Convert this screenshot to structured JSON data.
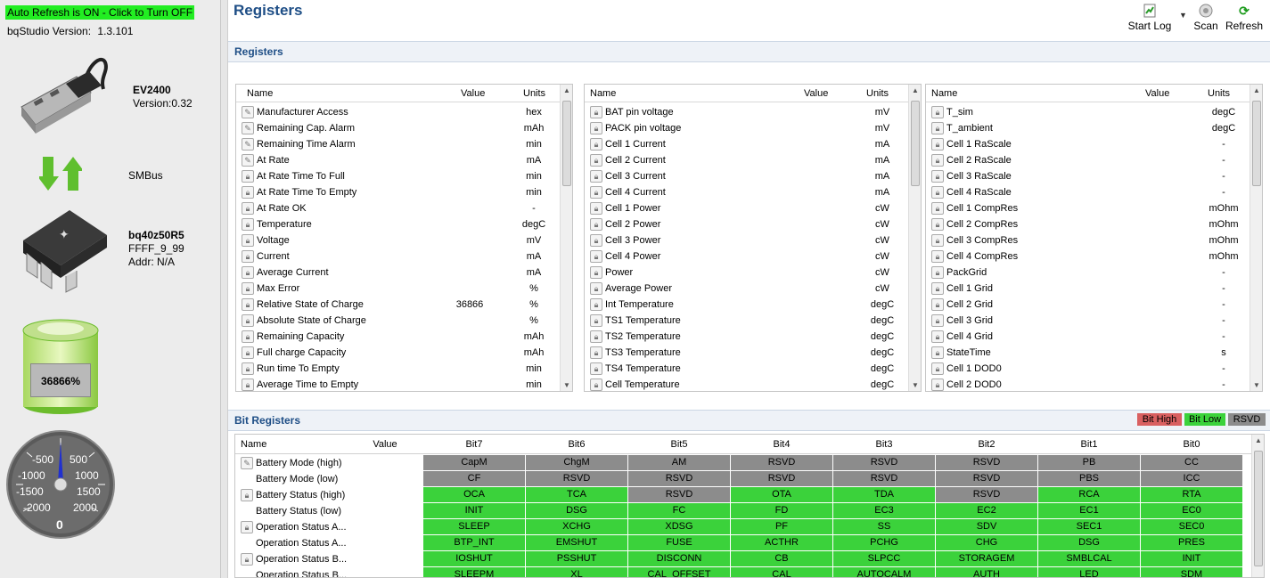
{
  "left": {
    "auto_refresh": "Auto Refresh is ON - Click to Turn OFF",
    "version_label": "bqStudio Version:",
    "version_value": "1.3.101",
    "adapter": {
      "name": "EV2400",
      "version": "Version:0.32"
    },
    "bus": "SMBus",
    "device": {
      "name": "bq40z50R5",
      "fw": "FFFF_9_99",
      "addr": "Addr: N/A"
    },
    "battery_pct": "36866%",
    "gauge": {
      "labels": [
        "-500",
        "-1000",
        "-1500",
        "-2000",
        "500",
        "1000",
        "1500",
        "2000"
      ],
      "value": "0"
    }
  },
  "page": {
    "title": "Registers"
  },
  "toolbar": {
    "start_log": "Start Log",
    "scan": "Scan",
    "refresh": "Refresh"
  },
  "registers": {
    "section_title": "Registers",
    "headers": {
      "name": "Name",
      "value": "Value",
      "units": "Units"
    },
    "col1": [
      {
        "name": "Manufacturer Access",
        "value": "",
        "units": "hex",
        "lock": false
      },
      {
        "name": "Remaining Cap. Alarm",
        "value": "",
        "units": "mAh",
        "lock": false
      },
      {
        "name": "Remaining Time Alarm",
        "value": "",
        "units": "min",
        "lock": false
      },
      {
        "name": "At Rate",
        "value": "",
        "units": "mA",
        "lock": false
      },
      {
        "name": "At Rate Time To Full",
        "value": "",
        "units": "min",
        "lock": true
      },
      {
        "name": "At Rate Time To Empty",
        "value": "",
        "units": "min",
        "lock": true
      },
      {
        "name": "At Rate OK",
        "value": "",
        "units": "-",
        "lock": true
      },
      {
        "name": "Temperature",
        "value": "",
        "units": "degC",
        "lock": true
      },
      {
        "name": "Voltage",
        "value": "",
        "units": "mV",
        "lock": true
      },
      {
        "name": "Current",
        "value": "",
        "units": "mA",
        "lock": true
      },
      {
        "name": "Average Current",
        "value": "",
        "units": "mA",
        "lock": true
      },
      {
        "name": "Max Error",
        "value": "",
        "units": "%",
        "lock": true
      },
      {
        "name": "Relative State of Charge",
        "value": "36866",
        "units": "%",
        "lock": true
      },
      {
        "name": "Absolute State of Charge",
        "value": "",
        "units": "%",
        "lock": true
      },
      {
        "name": "Remaining Capacity",
        "value": "",
        "units": "mAh",
        "lock": true
      },
      {
        "name": "Full charge Capacity",
        "value": "",
        "units": "mAh",
        "lock": true
      },
      {
        "name": "Run time To Empty",
        "value": "",
        "units": "min",
        "lock": true
      },
      {
        "name": "Average Time to Empty",
        "value": "",
        "units": "min",
        "lock": true
      }
    ],
    "col2": [
      {
        "name": "BAT pin voltage",
        "value": "",
        "units": "mV",
        "lock": true
      },
      {
        "name": "PACK pin voltage",
        "value": "",
        "units": "mV",
        "lock": true
      },
      {
        "name": "Cell 1 Current",
        "value": "",
        "units": "mA",
        "lock": true
      },
      {
        "name": "Cell 2 Current",
        "value": "",
        "units": "mA",
        "lock": true
      },
      {
        "name": "Cell 3 Current",
        "value": "",
        "units": "mA",
        "lock": true
      },
      {
        "name": "Cell 4 Current",
        "value": "",
        "units": "mA",
        "lock": true
      },
      {
        "name": "Cell 1 Power",
        "value": "",
        "units": "cW",
        "lock": true
      },
      {
        "name": "Cell 2 Power",
        "value": "",
        "units": "cW",
        "lock": true
      },
      {
        "name": "Cell 3 Power",
        "value": "",
        "units": "cW",
        "lock": true
      },
      {
        "name": "Cell 4 Power",
        "value": "",
        "units": "cW",
        "lock": true
      },
      {
        "name": "Power",
        "value": "",
        "units": "cW",
        "lock": true
      },
      {
        "name": "Average Power",
        "value": "",
        "units": "cW",
        "lock": true
      },
      {
        "name": "Int Temperature",
        "value": "",
        "units": "degC",
        "lock": true
      },
      {
        "name": "TS1 Temperature",
        "value": "",
        "units": "degC",
        "lock": true
      },
      {
        "name": "TS2 Temperature",
        "value": "",
        "units": "degC",
        "lock": true
      },
      {
        "name": "TS3 Temperature",
        "value": "",
        "units": "degC",
        "lock": true
      },
      {
        "name": "TS4 Temperature",
        "value": "",
        "units": "degC",
        "lock": true
      },
      {
        "name": "Cell Temperature",
        "value": "",
        "units": "degC",
        "lock": true
      }
    ],
    "col3": [
      {
        "name": "T_sim",
        "value": "",
        "units": "degC",
        "lock": true
      },
      {
        "name": "T_ambient",
        "value": "",
        "units": "degC",
        "lock": true
      },
      {
        "name": "Cell 1 RaScale",
        "value": "",
        "units": "-",
        "lock": true
      },
      {
        "name": "Cell 2 RaScale",
        "value": "",
        "units": "-",
        "lock": true
      },
      {
        "name": "Cell 3 RaScale",
        "value": "",
        "units": "-",
        "lock": true
      },
      {
        "name": "Cell 4 RaScale",
        "value": "",
        "units": "-",
        "lock": true
      },
      {
        "name": "Cell 1 CompRes",
        "value": "",
        "units": "mOhm",
        "lock": true
      },
      {
        "name": "Cell 2 CompRes",
        "value": "",
        "units": "mOhm",
        "lock": true
      },
      {
        "name": "Cell 3 CompRes",
        "value": "",
        "units": "mOhm",
        "lock": true
      },
      {
        "name": "Cell 4 CompRes",
        "value": "",
        "units": "mOhm",
        "lock": true
      },
      {
        "name": "PackGrid",
        "value": "",
        "units": "-",
        "lock": true
      },
      {
        "name": "Cell 1 Grid",
        "value": "",
        "units": "-",
        "lock": true
      },
      {
        "name": "Cell 2 Grid",
        "value": "",
        "units": "-",
        "lock": true
      },
      {
        "name": "Cell 3 Grid",
        "value": "",
        "units": "-",
        "lock": true
      },
      {
        "name": "Cell 4 Grid",
        "value": "",
        "units": "-",
        "lock": true
      },
      {
        "name": "StateTime",
        "value": "",
        "units": "s",
        "lock": true
      },
      {
        "name": "Cell 1 DOD0",
        "value": "",
        "units": "-",
        "lock": true
      },
      {
        "name": "Cell 2 DOD0",
        "value": "",
        "units": "-",
        "lock": true
      }
    ]
  },
  "bit_registers": {
    "section_title": "Bit Registers",
    "legend": {
      "high": "Bit High",
      "low": "Bit Low",
      "rsvd": "RSVD"
    },
    "headers": [
      "Name",
      "Value",
      "Bit7",
      "Bit6",
      "Bit5",
      "Bit4",
      "Bit3",
      "Bit2",
      "Bit1",
      "Bit0"
    ],
    "rows": [
      {
        "name": "Battery Mode (high)",
        "icon": "edit",
        "bits": [
          "CapM",
          "ChgM",
          "AM",
          "RSVD",
          "RSVD",
          "RSVD",
          "PB",
          "CC"
        ],
        "states": [
          "y",
          "y",
          "y",
          "y",
          "y",
          "y",
          "y",
          "y"
        ]
      },
      {
        "name": "Battery Mode (low)",
        "icon": "none",
        "bits": [
          "CF",
          "RSVD",
          "RSVD",
          "RSVD",
          "RSVD",
          "RSVD",
          "PBS",
          "ICC"
        ],
        "states": [
          "y",
          "y",
          "y",
          "y",
          "y",
          "y",
          "y",
          "y"
        ]
      },
      {
        "name": "Battery Status (high)",
        "icon": "lock",
        "bits": [
          "OCA",
          "TCA",
          "RSVD",
          "OTA",
          "TDA",
          "RSVD",
          "RCA",
          "RTA"
        ],
        "states": [
          "g",
          "g",
          "y",
          "g",
          "g",
          "y",
          "g",
          "g"
        ]
      },
      {
        "name": "Battery Status (low)",
        "icon": "none",
        "bits": [
          "INIT",
          "DSG",
          "FC",
          "FD",
          "EC3",
          "EC2",
          "EC1",
          "EC0"
        ],
        "states": [
          "g",
          "g",
          "g",
          "g",
          "g",
          "g",
          "g",
          "g"
        ]
      },
      {
        "name": "Operation Status A...",
        "icon": "lock",
        "bits": [
          "SLEEP",
          "XCHG",
          "XDSG",
          "PF",
          "SS",
          "SDV",
          "SEC1",
          "SEC0"
        ],
        "states": [
          "g",
          "g",
          "g",
          "g",
          "g",
          "g",
          "g",
          "g"
        ]
      },
      {
        "name": "Operation Status A...",
        "icon": "none",
        "bits": [
          "BTP_INT",
          "EMSHUT",
          "FUSE",
          "ACTHR",
          "PCHG",
          "CHG",
          "DSG",
          "PRES"
        ],
        "states": [
          "g",
          "g",
          "g",
          "g",
          "g",
          "g",
          "g",
          "g"
        ]
      },
      {
        "name": "Operation Status B...",
        "icon": "lock",
        "bits": [
          "IOSHUT",
          "PSSHUT",
          "DISCONN",
          "CB",
          "SLPCC",
          "STORAGEM",
          "SMBLCAL",
          "INIT"
        ],
        "states": [
          "g",
          "g",
          "g",
          "g",
          "g",
          "g",
          "g",
          "g"
        ]
      },
      {
        "name": "Operation Status B...",
        "icon": "none",
        "bits": [
          "SLEEPM",
          "XL",
          "CAL_OFFSET",
          "CAL",
          "AUTOCALM",
          "AUTH",
          "LED",
          "SDM"
        ],
        "states": [
          "g",
          "g",
          "g",
          "g",
          "g",
          "g",
          "g",
          "g"
        ]
      }
    ]
  }
}
